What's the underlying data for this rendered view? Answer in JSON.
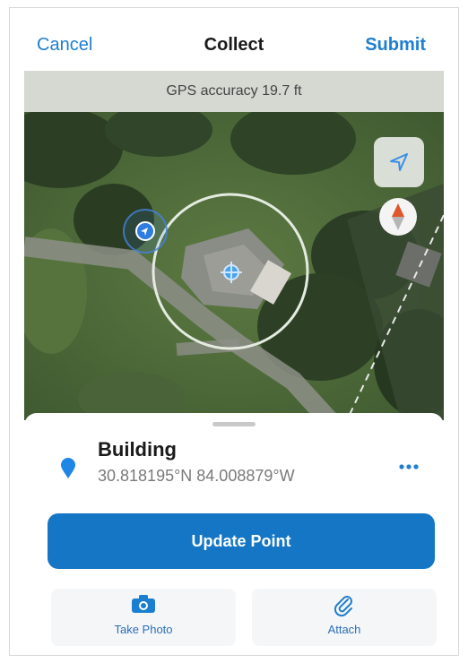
{
  "header": {
    "cancel_label": "Cancel",
    "title": "Collect",
    "submit_label": "Submit"
  },
  "gps_banner": "GPS accuracy 19.7 ft",
  "map": {
    "icons": [
      "navigation-arrow-icon",
      "compass-icon",
      "location-dot-icon",
      "crosshair-icon"
    ]
  },
  "feature": {
    "title": "Building",
    "coordinates": "30.818195°N  84.008879°W"
  },
  "actions": {
    "update_label": "Update Point",
    "take_photo_label": "Take Photo",
    "attach_label": "Attach"
  },
  "colors": {
    "accent": "#1f7fcf",
    "primary_button": "#1476c4",
    "highlight": "#f6f400"
  }
}
